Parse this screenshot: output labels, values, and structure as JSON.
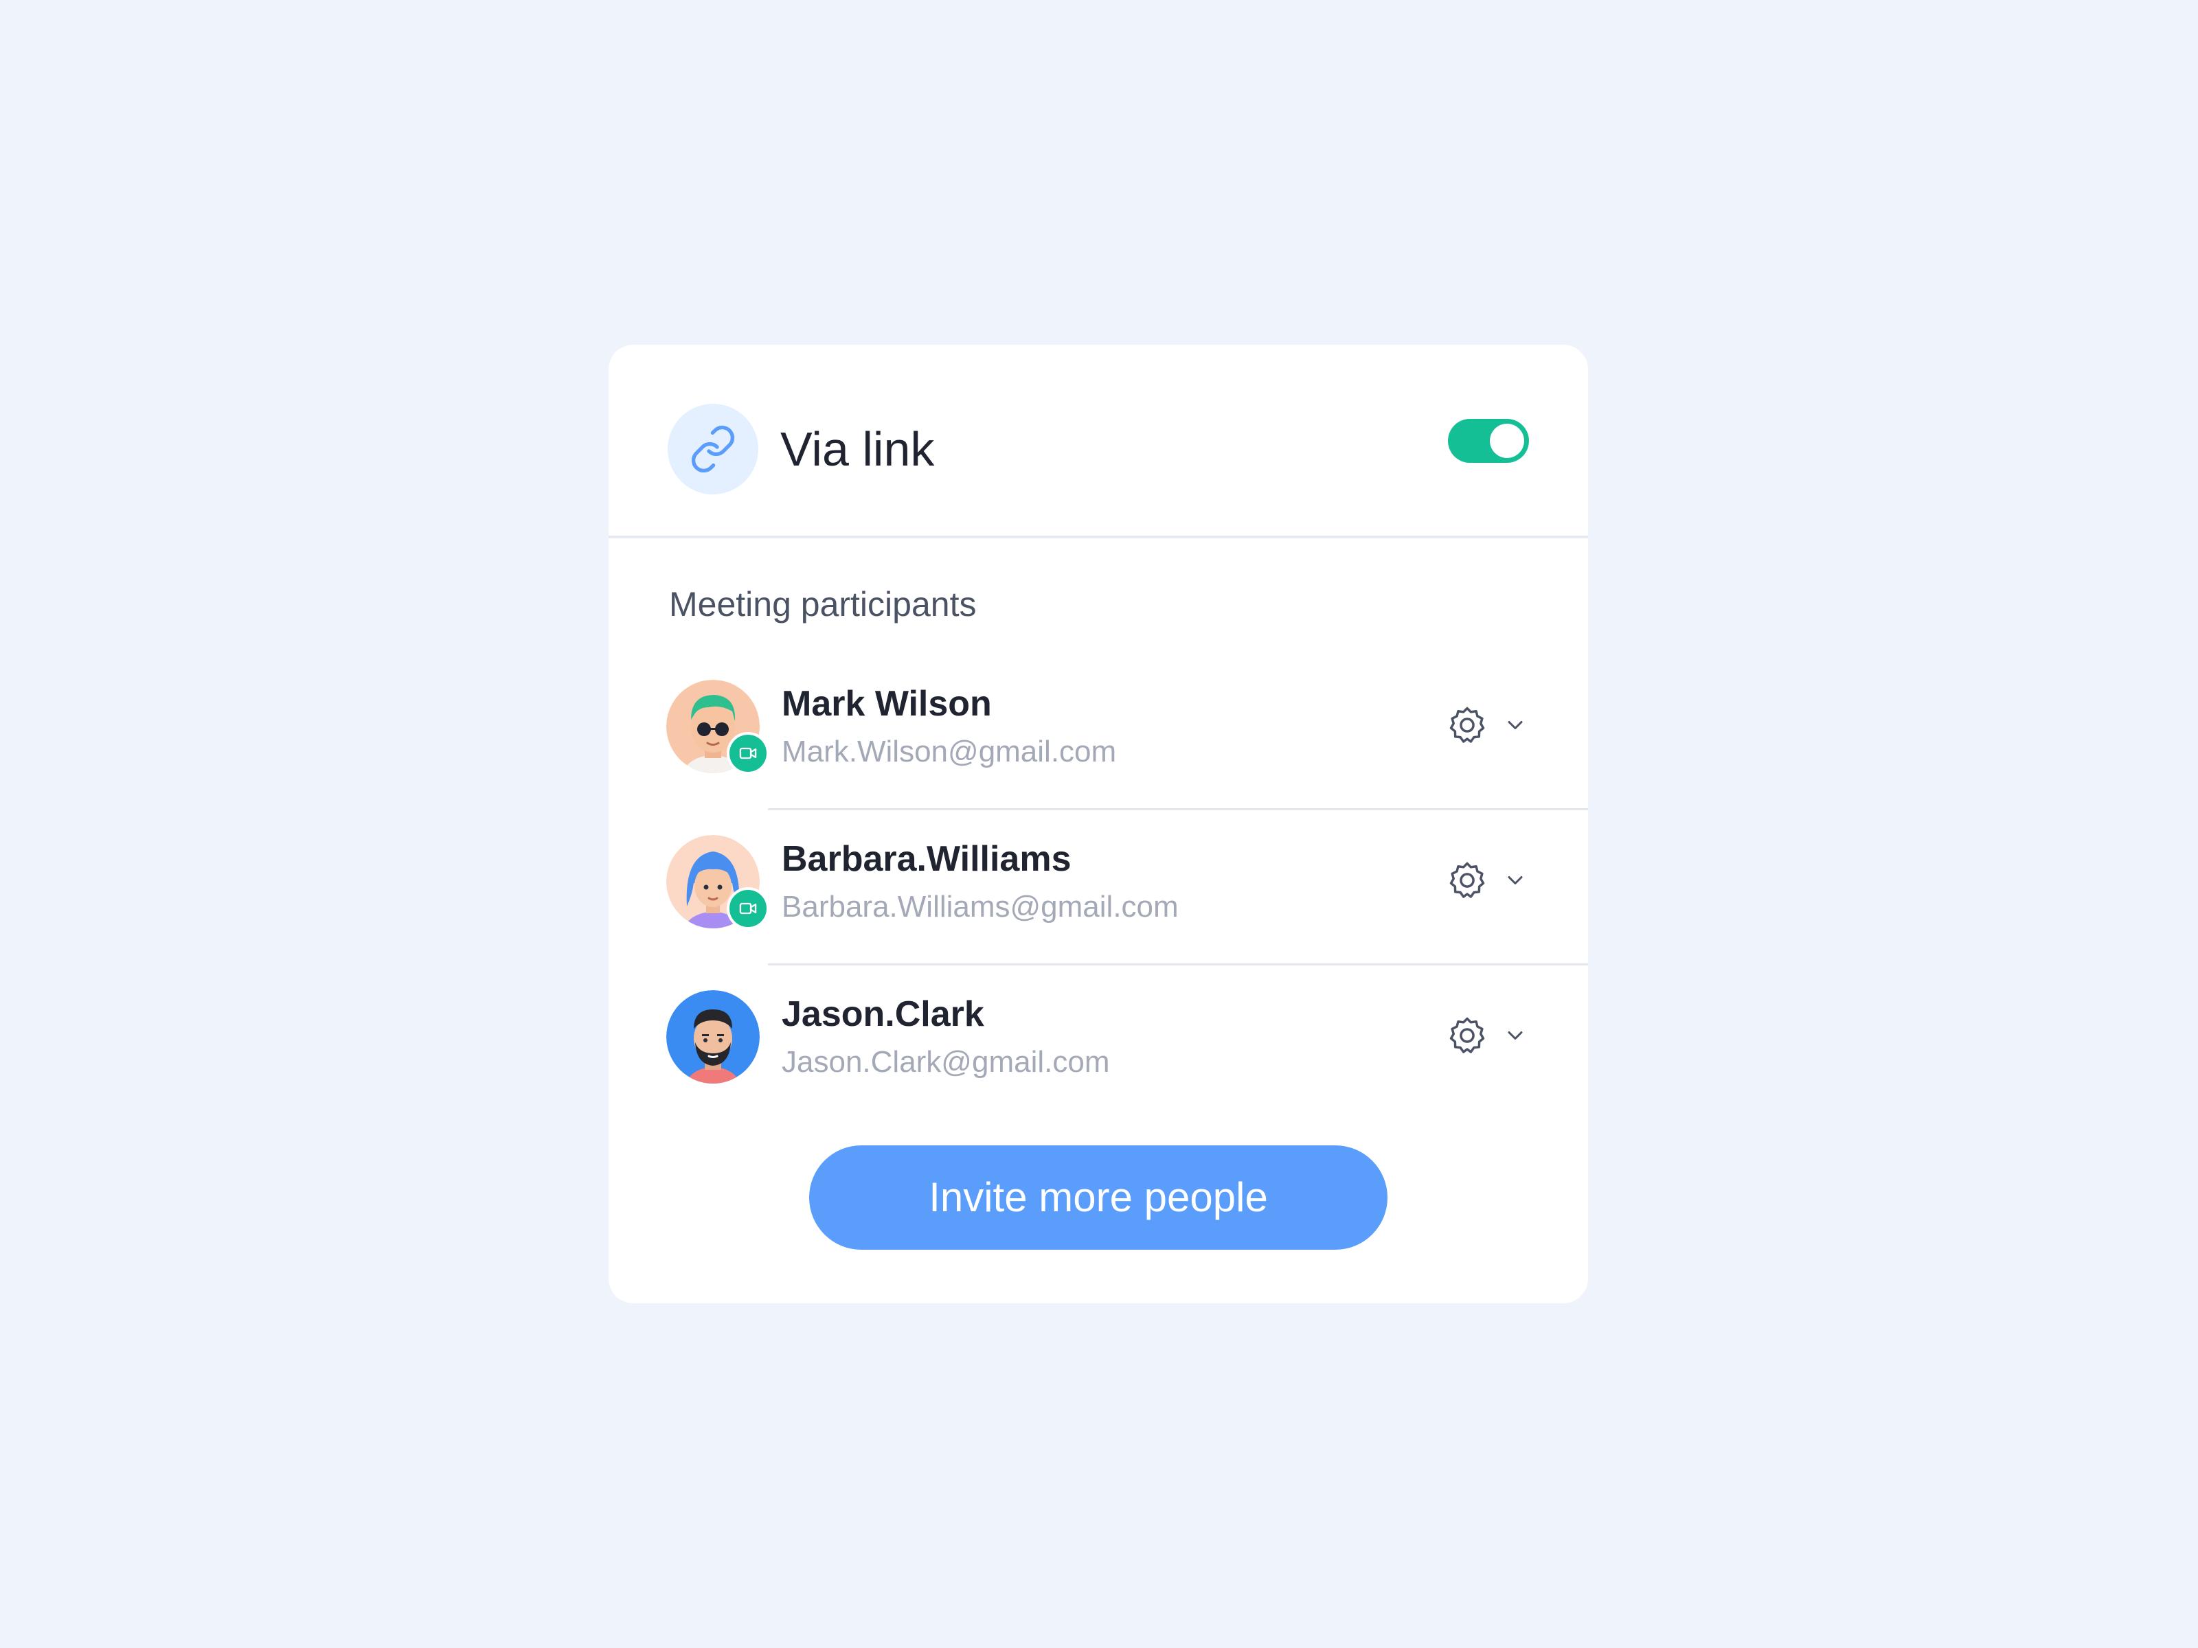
{
  "header": {
    "title": "Via link",
    "link_icon": "link-icon",
    "toggle_on": true,
    "toggle_color": "#14bf95"
  },
  "section": {
    "title": "Meeting participants"
  },
  "participants": [
    {
      "name": "Mark Wilson",
      "email": "Mark.Wilson@gmail.com",
      "video": true,
      "avatar": "avatar-mark-wilson"
    },
    {
      "name": "Barbara.Williams",
      "email": "Barbara.Williams@gmail.com",
      "video": true,
      "avatar": "avatar-barbara-williams"
    },
    {
      "name": "Jason.Clark",
      "email": "Jason.Clark@gmail.com",
      "video": false,
      "avatar": "avatar-jason-clark"
    }
  ],
  "invite_button": {
    "label": "Invite more people",
    "color": "#5b9dfb"
  },
  "colors": {
    "background": "#eff3fb",
    "card": "#ffffff",
    "accent_green": "#14bf95",
    "accent_blue": "#5b9dfb"
  }
}
